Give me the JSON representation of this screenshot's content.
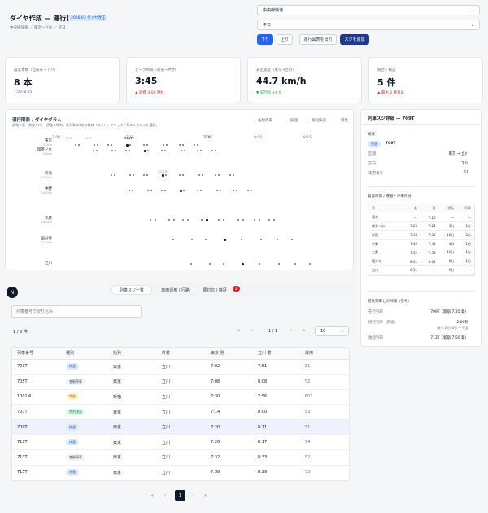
{
  "header": {
    "title": "ダイヤ作成 — 運行図表",
    "badge": "2026.03 ダイヤ改正",
    "breadcrumb": "中央線快速 ／ 東京〜立川 ／ 平日",
    "line_select": "中央線快速",
    "day_select": "平日",
    "dir_down": "下り",
    "dir_up": "上り",
    "export_label": "運行図表を出力",
    "add_label": "スジを追加"
  },
  "kpis": [
    {
      "label": "設定本数（当該帯・下り）",
      "value": "8 本",
      "sub": "7:00–8:35",
      "sub_color": "muted"
    },
    {
      "label": "ピーク時隔（新宿→中野）",
      "value": "3:45",
      "sub": "▲ 目標 4:00 割れ",
      "sub_color": "red"
    },
    {
      "label": "表定速度（東京→立川）",
      "value": "44.7 km/h",
      "sub": "▼ 前回比 +0.9",
      "sub_color": "green"
    },
    {
      "label": "競合・検証",
      "value": "5 件",
      "sub": "▲ 最大 2 要対応",
      "sub_color": "red"
    }
  ],
  "diagram": {
    "title": "運行図表 / ダイヤグラム",
    "subtitle": "縦軸＝駅（営業キロ）・横軸＝時刻。各列車は1本の斜線（スジ）。クリック／Enter でスジを選択。",
    "legend": [
      "各駅停車",
      "快速",
      "特別快速",
      "特急"
    ],
    "times": [
      "7:00",
      "7:15",
      "7:30",
      "7:45",
      "8:00",
      "8:15"
    ],
    "small_labels": [
      "701T",
      "703T",
      "709T",
      "1001M"
    ],
    "stations": [
      {
        "name": "東京",
        "km": "0.0km"
      },
      {
        "name": "御茶ノ水",
        "km": "2.6km"
      },
      {
        "name": "新宿",
        "km": "10.3km"
      },
      {
        "name": "中野",
        "km": "14.7km"
      },
      {
        "name": "三鷹",
        "km": "24.1km"
      },
      {
        "name": "国分寺",
        "km": "31.4km"
      },
      {
        "name": "立川",
        "km": ""
      }
    ]
  },
  "tabs": {
    "avatar": "N",
    "list": "列車スジ一覧",
    "vehicle": "車両運用 / 行路",
    "check": "要対応 / 検証",
    "check_count": "2"
  },
  "table": {
    "search_placeholder": "列車番号で絞り込み",
    "range": "1 / 8 件",
    "page": "1 / 1",
    "page_size": "10",
    "headers": [
      "列車番号",
      "種別",
      "始発",
      "終着",
      "東京 発",
      "立川 着",
      "運用"
    ],
    "rows": [
      {
        "no": "703T",
        "type": "快速",
        "type_key": "rapid",
        "from": "東京",
        "to": "立川",
        "dep": "7:02",
        "arr": "7:51",
        "op": "51"
      },
      {
        "no": "705T",
        "type": "各駅停車",
        "type_key": "local",
        "from": "東京",
        "to": "立川",
        "dep": "7:08",
        "arr": "8:08",
        "op": "52"
      },
      {
        "no": "1001M",
        "type": "特急",
        "type_key": "ltd",
        "from": "新宿",
        "to": "立川",
        "dep": "7:30",
        "arr": "7:56",
        "op": "E01"
      },
      {
        "no": "707T",
        "type": "特別快速",
        "type_key": "special",
        "from": "東京",
        "to": "立川",
        "dep": "7:14",
        "arr": "8:00",
        "op": "53"
      },
      {
        "no": "709T",
        "type": "快速",
        "type_key": "rapid",
        "from": "東京",
        "to": "立川",
        "dep": "7:20",
        "arr": "8:11",
        "op": "51"
      },
      {
        "no": "711T",
        "type": "快速",
        "type_key": "rapid",
        "from": "東京",
        "to": "立川",
        "dep": "7:26",
        "arr": "8:17",
        "op": "54"
      },
      {
        "no": "713T",
        "type": "各駅停車",
        "type_key": "local",
        "from": "東京",
        "to": "立川",
        "dep": "7:32",
        "arr": "8:33",
        "op": "52"
      },
      {
        "no": "715T",
        "type": "快速",
        "type_key": "rapid",
        "from": "東京",
        "to": "立川",
        "dep": "7:38",
        "arr": "8:29",
        "op": "53"
      }
    ],
    "pager_current": "1"
  },
  "detail": {
    "title": "列車スジ詳細 — 709T",
    "overview": "概要",
    "type_badge": "快速",
    "train_no": "709T",
    "rows": [
      {
        "k": "区間",
        "v": "東京 → 立川"
      },
      {
        "k": "方向",
        "v": "下り"
      },
      {
        "k": "運用番号",
        "v": "51"
      }
    ],
    "stops_title": "着発時刻 / 運転・停車時分",
    "stops_headers": [
      "駅",
      "着",
      "発",
      "運転",
      "停車"
    ],
    "stops": [
      [
        "東京",
        "—",
        "7:20",
        "—",
        "—"
      ],
      [
        "御茶ノ水",
        "7:23",
        "7:24",
        "3分",
        "1分"
      ],
      [
        "新宿",
        "7:34",
        "7:36",
        "10分",
        "2分"
      ],
      [
        "中野",
        "7:40",
        "7:41",
        "4分",
        "1分"
      ],
      [
        "三鷹",
        "7:52",
        "7:53",
        "11分",
        "1分"
      ],
      [
        "国分寺",
        "8:01",
        "8:02",
        "8分",
        "1分"
      ],
      [
        "立川",
        "8:11",
        "—",
        "9分",
        "—"
      ]
    ],
    "gap_title": "前後列車との時隔（参考）",
    "gaps": [
      {
        "k": "先行列車",
        "v": "709T（新宿 7:35 発）"
      },
      {
        "k": "続行列車（新宿）",
        "v": "2:00秒",
        "v2": "最小 2分30秒 → 不足"
      },
      {
        "k": "後続列車",
        "v": "713T（新宿 7:50 発）"
      }
    ]
  }
}
